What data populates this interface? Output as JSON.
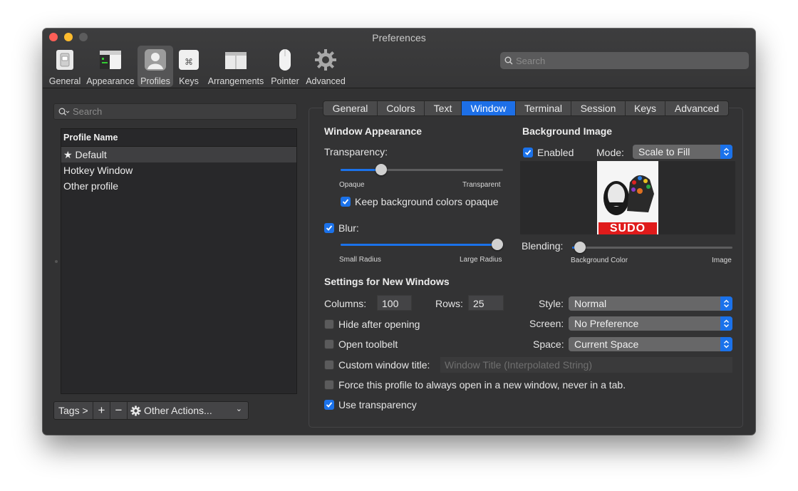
{
  "window": {
    "title": "Preferences"
  },
  "toolbar": {
    "items": [
      {
        "label": "General",
        "icon": "general-switch-icon"
      },
      {
        "label": "Appearance",
        "icon": "appearance-window-icon"
      },
      {
        "label": "Profiles",
        "icon": "profiles-person-icon",
        "active": true
      },
      {
        "label": "Keys",
        "icon": "keys-command-icon"
      },
      {
        "label": "Arrangements",
        "icon": "arrangements-icon"
      },
      {
        "label": "Pointer",
        "icon": "pointer-mouse-icon"
      },
      {
        "label": "Advanced",
        "icon": "advanced-gear-icon"
      }
    ],
    "search_placeholder": "Search"
  },
  "profiles": {
    "search_placeholder": "Search",
    "column_header": "Profile Name",
    "rows": [
      "Default",
      "Hotkey Window",
      "Other profile"
    ],
    "selected_index": 0,
    "tags_label": "Tags >",
    "add_label": "+",
    "remove_label": "−",
    "other_actions_label": "Other Actions..."
  },
  "tabs": [
    "General",
    "Colors",
    "Text",
    "Window",
    "Terminal",
    "Session",
    "Keys",
    "Advanced"
  ],
  "active_tab": "Window",
  "window_appearance": {
    "title": "Window Appearance",
    "transparency_label": "Transparency:",
    "transparency_value": 0.25,
    "opaque_label": "Opaque",
    "transparent_label": "Transparent",
    "keep_bg_opaque_label": "Keep background colors opaque",
    "keep_bg_opaque_checked": true,
    "blur_label": "Blur:",
    "blur_checked": true,
    "blur_value": 1.0,
    "small_radius_label": "Small Radius",
    "large_radius_label": "Large Radius"
  },
  "background_image": {
    "title": "Background Image",
    "enabled_label": "Enabled",
    "enabled_checked": true,
    "mode_label": "Mode:",
    "mode_value": "Scale to Fill",
    "image_caption": "SUDO",
    "blending_label": "Blending:",
    "blending_value": 0.05,
    "background_color_label": "Background Color",
    "image_label": "Image"
  },
  "new_windows": {
    "title": "Settings for New Windows",
    "columns_label": "Columns:",
    "columns_value": "100",
    "rows_label": "Rows:",
    "rows_value": "25",
    "style_label": "Style:",
    "style_value": "Normal",
    "screen_label": "Screen:",
    "screen_value": "No Preference",
    "space_label": "Space:",
    "space_value": "Current Space",
    "hide_after_opening_label": "Hide after opening",
    "hide_after_opening_checked": false,
    "open_toolbelt_label": "Open toolbelt",
    "open_toolbelt_checked": false,
    "custom_title_label": "Custom window title:",
    "custom_title_checked": false,
    "custom_title_placeholder": "Window Title (Interpolated String)",
    "force_new_window_label": "Force this profile to always open in a new window, never in a tab.",
    "force_new_window_checked": false,
    "use_transparency_label": "Use transparency",
    "use_transparency_checked": true
  },
  "colors": {
    "accent": "#1b72ea",
    "window_bg": "#323233",
    "close": "#fd5f57",
    "minimize": "#fdbb2e"
  }
}
